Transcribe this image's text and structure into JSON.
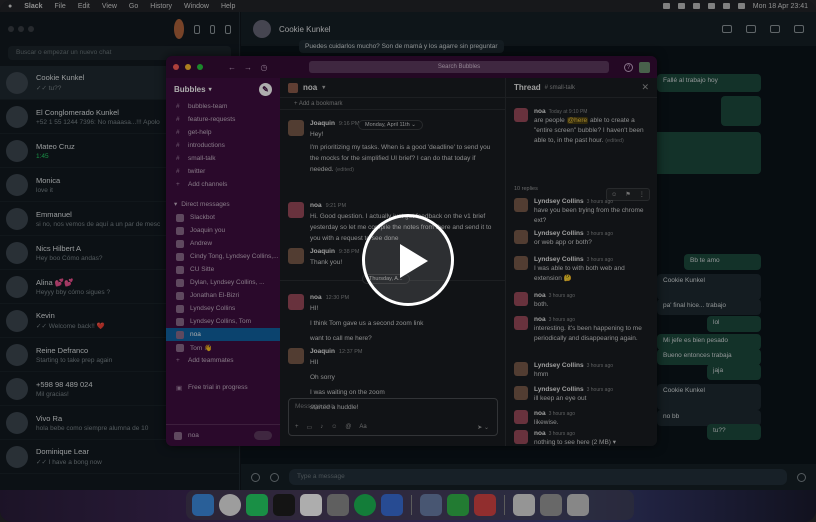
{
  "menubar": {
    "app_name": "Slack",
    "menus": [
      "File",
      "Edit",
      "View",
      "Go",
      "History",
      "Window",
      "Help"
    ],
    "datetime": "Mon 18 Apr 23:41"
  },
  "whatsapp": {
    "search_placeholder": "Buscar o empezar un nuevo chat",
    "header_name": "Cookie Kunkel",
    "input_placeholder": "Type a message",
    "chats": [
      {
        "name": "Cookie Kunkel",
        "preview": "✓✓ tu??"
      },
      {
        "name": "El Conglomerado Kunkel",
        "preview": "+52 1 55 1244 7396: No maaasa...!!! Apolo"
      },
      {
        "name": "Mateo Cruz",
        "preview": "1:45"
      },
      {
        "name": "Monica",
        "preview": "love it"
      },
      {
        "name": "Emmanuel",
        "preview": "si no, nos vemos de aquí a un par de mesc"
      },
      {
        "name": "Nics Hilbert A",
        "preview": "Hey boo  Cómo andas?"
      },
      {
        "name": "Alina 💕💕",
        "preview": "Heyyy bby cómo sigues ?"
      },
      {
        "name": "Kevin",
        "preview": "✓✓ Welcome back!! ❤️"
      },
      {
        "name": "Reine Defranco",
        "preview": "Starting to take prep again"
      },
      {
        "name": "+598 98 489 024",
        "preview": "Mil gracias!"
      },
      {
        "name": "Vivo Ra",
        "preview": "hola bebe como siempre alumna de 10"
      },
      {
        "name": "Dominique Lear",
        "preview": "✓✓ I have a bong now"
      }
    ],
    "bubbles": [
      "Puedes cuidarlos mucho? Son de mamá y los agarre sin preguntar",
      "Fallé al trabajo hoy",
      "Bb te amo",
      "Cookie Kunkel",
      "pa' final hice... trabajo",
      "lol",
      "Mi jefe es bien pesado",
      "Bueno entonces trabaja",
      "jaja",
      "Cookie Kunkel",
      "no bb",
      "tu??"
    ]
  },
  "slack": {
    "search_placeholder": "Search Bubbles",
    "workspace": "Bubbles",
    "channels": [
      "bubbles-team",
      "feature-requests",
      "get-help",
      "introductions",
      "small-talk",
      "twitter"
    ],
    "add_channels": "Add channels",
    "dm_section": "Direct messages",
    "dms": [
      "Slackbot",
      "Joaquin  you",
      "Andrew",
      "Cindy Tong, Lyndsey Collins,...",
      "CU Sitte",
      "Dylan, Lyndsey Collins, ...",
      "Jonathan El-Bizri",
      "Lyndsey Collins",
      "Lyndsey Collins, Tom",
      "noa",
      "Tom 👋"
    ],
    "add_teammates": "Add teammates",
    "free_trial": "Free trial in progress",
    "footer_user": "noa",
    "channel_name": "noa",
    "add_bookmark": "+ Add a bookmark",
    "date_pill_1": "Monday, April 11th ⌄",
    "date_pill_2": "Thursday, A...",
    "composer_placeholder": "Message noa",
    "messages": [
      {
        "who": "Joaquin",
        "time": "9:16 PM",
        "lines": [
          "Hey!",
          "I'm prioritizing my tasks. When is a good 'deadline' to send you the mocks for the simplified UI brief? I can do that today if needed."
        ],
        "edited": "(edited)"
      },
      {
        "who": "noa",
        "time": "9:21 PM",
        "lines": [
          "Hi. Good question. I actually just got feedback on the v1 brief yesterday so let me compile the notes from there and send it to you with a request to see done"
        ]
      },
      {
        "who": "Joaquin",
        "time": "9:38 PM",
        "lines": [
          "Thank you!"
        ]
      },
      {
        "who": "noa",
        "time": "12:30 PM",
        "lines": [
          "HI!",
          "I think Tom gave us a second zoom link",
          "want to call me here?"
        ]
      },
      {
        "who": "Joaquin",
        "time": "12:37 PM",
        "lines": [
          "HII",
          "Oh sorry",
          "I was waiting on the zoom",
          "started a huddle!"
        ]
      }
    ],
    "thread": {
      "title": "Thread",
      "channel": "# small-talk",
      "replies": "10 replies",
      "messages": [
        {
          "who": "noa",
          "time": "Today at 9:10 PM",
          "text_before": "are people ",
          "mention": "@here",
          "text_after": " able to create a \"entire screen\" bubble? I haven't been able to, in the past hour.",
          "edited": "(edited)"
        },
        {
          "who": "Lyndsey Collins",
          "time": "3 hours ago",
          "text": "have you been trying from the chrome ext?"
        },
        {
          "who": "Lyndsey Collins",
          "time": "3 hours ago",
          "text": "or web app or both?"
        },
        {
          "who": "Lyndsey Collins",
          "time": "3 hours ago",
          "text": "I was able to with both web and extension 🤔"
        },
        {
          "who": "noa",
          "time": "3 hours ago",
          "text": "both."
        },
        {
          "who": "noa",
          "time": "3 hours ago",
          "text": "interesting. it's been happening to me periodically and disappearing again."
        },
        {
          "who": "Lyndsey Collins",
          "time": "3 hours ago",
          "text": "hmm"
        },
        {
          "who": "Lyndsey Collins",
          "time": "3 hours ago",
          "text": "ill keep an eye out"
        },
        {
          "who": "noa",
          "time": "3 hours ago",
          "text": "likewise."
        },
        {
          "who": "noa",
          "time": "3 hours ago",
          "text": "nothing to see here (2 MB) ▾"
        }
      ]
    }
  },
  "video_overlay": {
    "control": "play-button"
  },
  "dock": {
    "apps": [
      "finder",
      "chrome",
      "whatsapp",
      "figma",
      "slack",
      "settings",
      "spotify",
      "tasks",
      "preview",
      "messages",
      "screen-recorder",
      "documents",
      "files",
      "trash"
    ]
  }
}
